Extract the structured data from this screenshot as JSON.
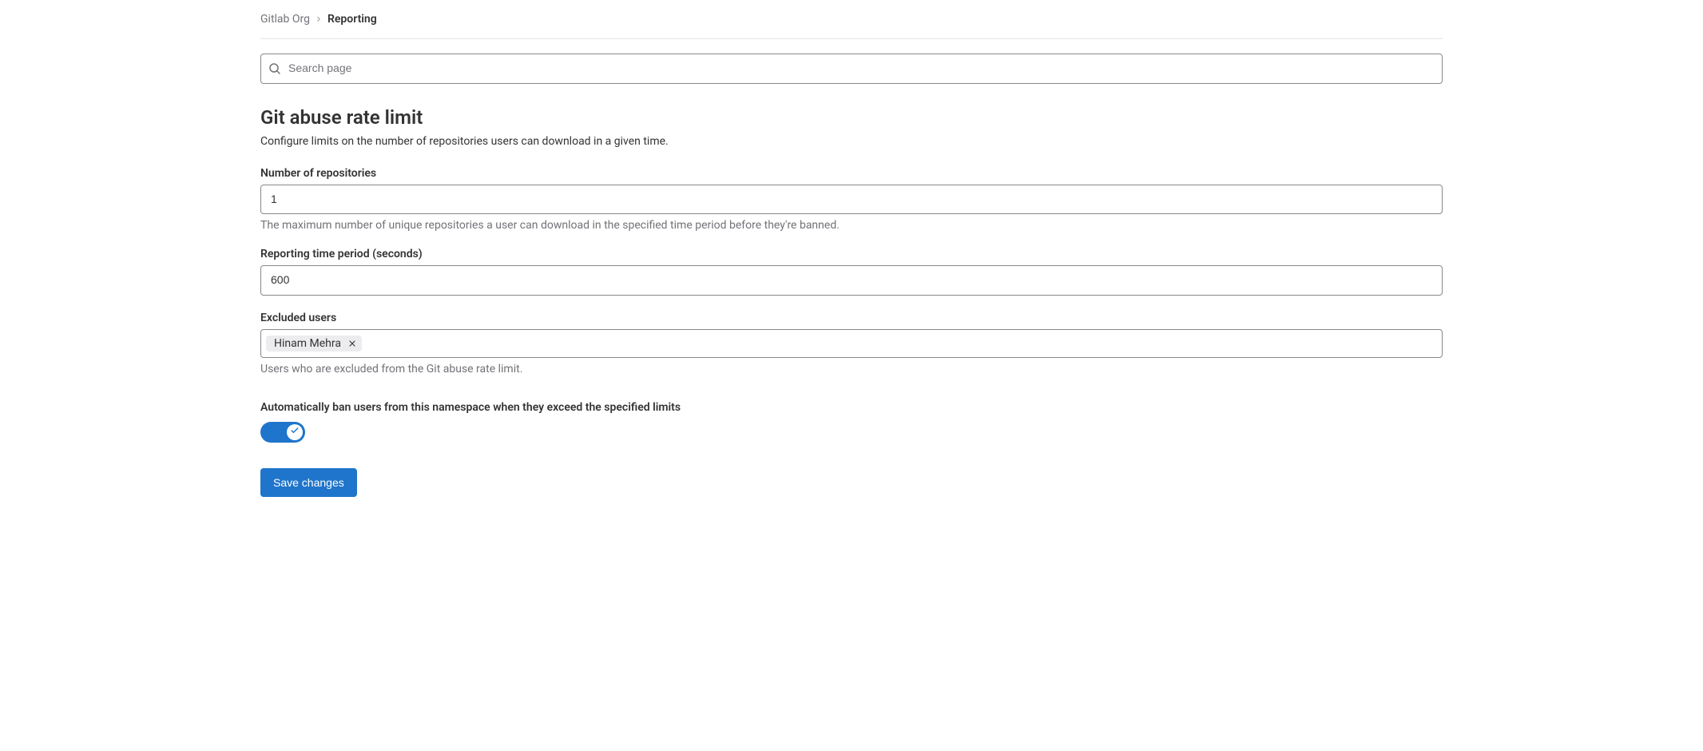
{
  "breadcrumb": {
    "parent": "Gitlab Org",
    "current": "Reporting"
  },
  "search": {
    "placeholder": "Search page"
  },
  "page": {
    "title": "Git abuse rate limit",
    "description": "Configure limits on the number of repositories users can download in a given time."
  },
  "form": {
    "num_repos": {
      "label": "Number of repositories",
      "value": "1",
      "help": "The maximum number of unique repositories a user can download in the specified time period before they're banned."
    },
    "time_period": {
      "label": "Reporting time period (seconds)",
      "value": "600"
    },
    "excluded_users": {
      "label": "Excluded users",
      "tokens": [
        "Hinam Mehra"
      ],
      "help": "Users who are excluded from the Git abuse rate limit."
    },
    "auto_ban": {
      "label": "Automatically ban users from this namespace when they exceed the specified limits",
      "enabled": true
    },
    "save_label": "Save changes"
  }
}
